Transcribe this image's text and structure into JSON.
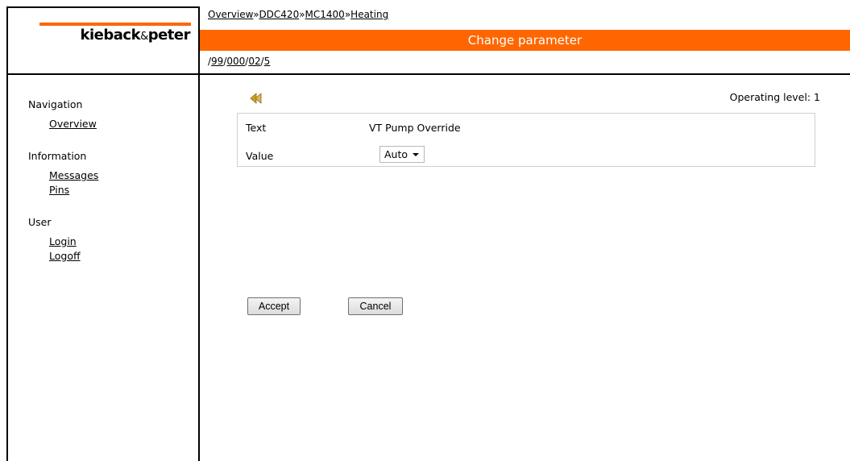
{
  "header": {
    "logo": {
      "brand_left": "kieback",
      "brand_amp": "&",
      "brand_right": "peter",
      "accent_color": "#ff6600"
    },
    "breadcrumb": [
      {
        "label": "Overview"
      },
      {
        "label": "DDC420"
      },
      {
        "label": "MC1400"
      },
      {
        "label": "Heating"
      }
    ],
    "breadcrumb_separator": "»",
    "title": "Change parameter",
    "path_prefix": "/",
    "path": [
      {
        "label": "99"
      },
      {
        "label": "000"
      },
      {
        "label": "02"
      },
      {
        "label": "5"
      }
    ],
    "path_separator": "/"
  },
  "sidebar": {
    "groups": [
      {
        "heading": "Navigation",
        "links": [
          {
            "label": "Overview"
          }
        ]
      },
      {
        "heading": "Information",
        "links": [
          {
            "label": "Messages"
          },
          {
            "label": "Pins"
          }
        ]
      },
      {
        "heading": "User",
        "links": [
          {
            "label": "Login"
          },
          {
            "label": "Logoff"
          }
        ]
      }
    ]
  },
  "content": {
    "back_icon": "back-arrow-icon",
    "operating_level": "Operating level: 1",
    "rows": {
      "text_label": "Text",
      "text_value": "VT Pump Override",
      "value_label": "Value",
      "value_selected": "Auto"
    },
    "buttons": {
      "accept": "Accept",
      "cancel": "Cancel"
    }
  }
}
